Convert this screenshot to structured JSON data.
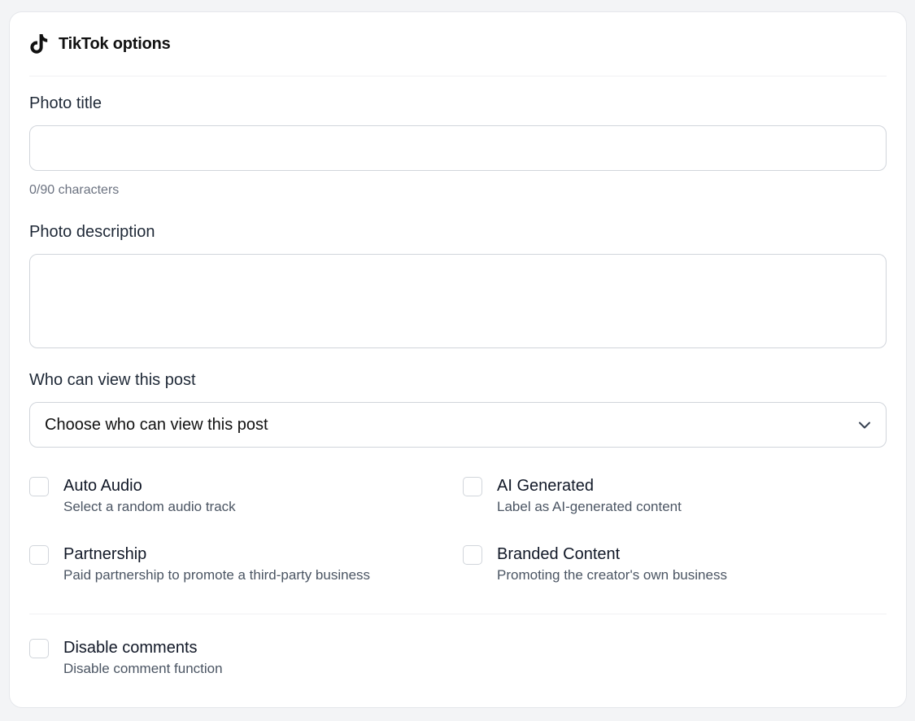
{
  "header": {
    "icon": "tiktok-icon",
    "title": "TikTok options"
  },
  "photo_title": {
    "label": "Photo title",
    "value": "",
    "counter": "0/90 characters"
  },
  "photo_description": {
    "label": "Photo description",
    "value": ""
  },
  "privacy": {
    "label": "Who can view this post",
    "selected": "Choose who can view this post",
    "icon": "chevron-down-icon"
  },
  "options": [
    {
      "label": "Auto Audio",
      "desc": "Select a random audio track",
      "checked": false
    },
    {
      "label": "AI Generated",
      "desc": "Label as AI-generated content",
      "checked": false
    },
    {
      "label": "Partnership",
      "desc": "Paid partnership to promote a third-party business",
      "checked": false
    },
    {
      "label": "Branded Content",
      "desc": "Promoting the creator's own business",
      "checked": false
    }
  ],
  "comments": {
    "label": "Disable comments",
    "desc": "Disable comment function",
    "checked": false
  },
  "colors": {
    "background": "#f3f4f6",
    "card": "#ffffff",
    "border": "#d1d5db",
    "muted_text": "#6b7280"
  }
}
